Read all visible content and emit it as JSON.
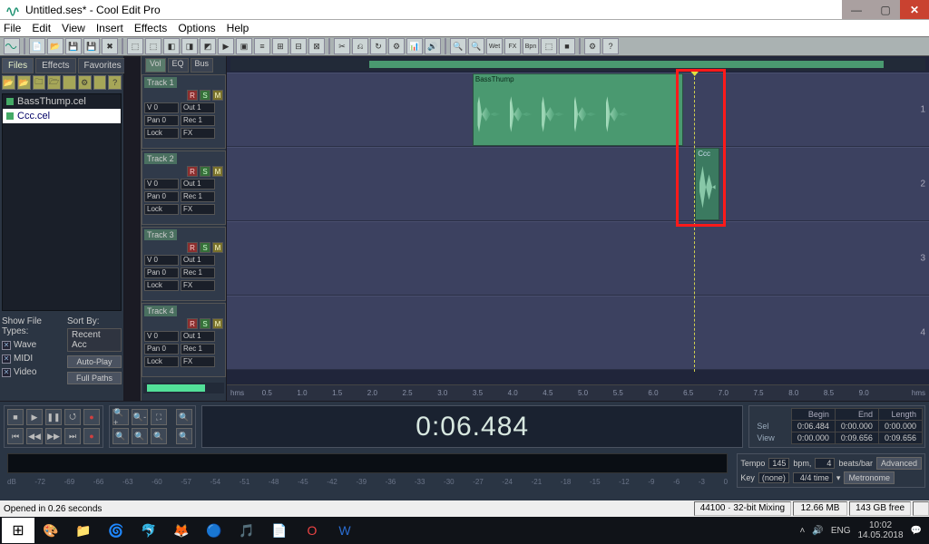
{
  "title": "Untitled.ses* - Cool Edit Pro",
  "window_buttons": {
    "min": "—",
    "max": "▢",
    "close": "✕"
  },
  "menu": [
    "File",
    "Edit",
    "View",
    "Insert",
    "Effects",
    "Options",
    "Help"
  ],
  "left_panel": {
    "tabs": [
      "Files",
      "Effects",
      "Favorites"
    ],
    "files": [
      {
        "name": "BassThump.cel"
      },
      {
        "name": "Ccc.cel"
      }
    ],
    "show_types_label": "Show File Types:",
    "sort_label": "Sort By:",
    "types": [
      "Wave",
      "MIDI",
      "Video"
    ],
    "sort_value": "Recent Acc",
    "btn_autoplay": "Auto-Play",
    "btn_fullpaths": "Full Paths"
  },
  "view_tabs": [
    "Vol",
    "EQ",
    "Bus"
  ],
  "tracks": [
    {
      "name": "Track 1",
      "vol": "V 0",
      "out": "Out 1",
      "pan": "Pan 0",
      "rec": "Rec 1",
      "lock": "Lock",
      "fx": "FX"
    },
    {
      "name": "Track 2",
      "vol": "V 0",
      "out": "Out 1",
      "pan": "Pan 0",
      "rec": "Rec 1",
      "lock": "Lock",
      "fx": "FX"
    },
    {
      "name": "Track 3",
      "vol": "V 0",
      "out": "Out 1",
      "pan": "Pan 0",
      "rec": "Rec 1",
      "lock": "Lock",
      "fx": "FX"
    },
    {
      "name": "Track 4",
      "vol": "V 0",
      "out": "Out 1",
      "pan": "Pan 0",
      "rec": "Rec 1",
      "lock": "Lock",
      "fx": "FX"
    }
  ],
  "clips": {
    "track1": {
      "name": "BassThump"
    },
    "track2": {
      "name": "Ccc"
    }
  },
  "ruler": {
    "hms_label": "hms",
    "ticks": [
      "0.5",
      "1.0",
      "1.5",
      "2.0",
      "2.5",
      "3.0",
      "3.5",
      "4.0",
      "4.5",
      "5.0",
      "5.5",
      "6.0",
      "6.5",
      "7.0",
      "7.5",
      "8.0",
      "8.5",
      "9.0"
    ]
  },
  "bigtime": "0:06.484",
  "sel_table": {
    "cols": [
      "Begin",
      "End",
      "Length"
    ],
    "rows": [
      {
        "label": "Sel",
        "begin": "0:06.484",
        "end": "0:00.000",
        "length": "0:00.000"
      },
      {
        "label": "View",
        "begin": "0:00.000",
        "end": "0:09.656",
        "length": "0:09.656"
      }
    ]
  },
  "tempo": {
    "tempo_label": "Tempo",
    "tempo_val": "145",
    "bpm": "bpm,",
    "beats_val": "4",
    "beats_label": "beats/bar",
    "adv": "Advanced",
    "key_label": "Key",
    "key_val": "(none)",
    "sig": "4/4 time",
    "metronome": "Metronome"
  },
  "db_scale": [
    "dB",
    "-72",
    "-69",
    "-66",
    "-63",
    "-60",
    "-57",
    "-54",
    "-51",
    "-48",
    "-45",
    "-42",
    "-39",
    "-36",
    "-33",
    "-30",
    "-27",
    "-24",
    "-21",
    "-18",
    "-15",
    "-12",
    "-9",
    "-6",
    "-3",
    "0"
  ],
  "statusbar": {
    "left": "Opened in 0.26 seconds",
    "segs": [
      "44100 · 32-bit Mixing",
      "12.66 MB",
      "143 GB free"
    ]
  },
  "tray": {
    "lang": "ENG",
    "time": "10:02",
    "date": "14.05.2018"
  }
}
